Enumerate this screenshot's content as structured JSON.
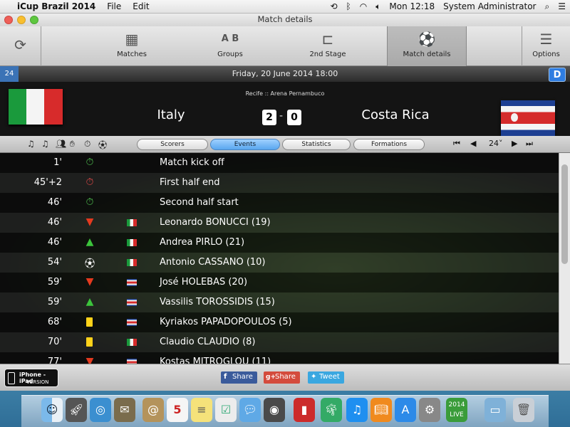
{
  "menubar": {
    "app_name": "iCup Brazil 2014",
    "menus": [
      "File",
      "Edit"
    ],
    "clock": "Mon 12:18",
    "user": "System Administrator"
  },
  "window": {
    "title": "Match details"
  },
  "toolbar": {
    "items": [
      {
        "label": "Matches",
        "icon": "calendar-icon"
      },
      {
        "label": "Groups",
        "icon": "groups-icon"
      },
      {
        "label": "2nd Stage",
        "icon": "bracket-icon"
      },
      {
        "label": "Match details",
        "icon": "soccer-ball-icon"
      },
      {
        "label": "Options",
        "icon": "list-icon"
      }
    ]
  },
  "match": {
    "number": "24",
    "date": "Friday, 20 June 2014 18:00",
    "group": "D",
    "venue": "Recife :: Arena Pernambuco",
    "home_team": "Italy",
    "away_team": "Costa Rica",
    "home_score": "2",
    "away_score": "0"
  },
  "tabs": [
    {
      "label": "Scorers",
      "selected": false
    },
    {
      "label": "Events",
      "selected": true
    },
    {
      "label": "Statistics",
      "selected": false
    },
    {
      "label": "Formations",
      "selected": false
    }
  ],
  "pager": {
    "value": "24"
  },
  "events": [
    {
      "minute": "1'",
      "icon": "stopwatch-green",
      "team": "",
      "text": "Match kick off"
    },
    {
      "minute": "45'+2",
      "icon": "stopwatch-red",
      "team": "",
      "text": "First half end"
    },
    {
      "minute": "46'",
      "icon": "stopwatch-green",
      "team": "",
      "text": "Second half start"
    },
    {
      "minute": "46'",
      "icon": "arrow-down-red",
      "team": "italy",
      "text": "Leonardo BONUCCI (19)"
    },
    {
      "minute": "46'",
      "icon": "arrow-up-green",
      "team": "italy",
      "text": "Andrea PIRLO (21)"
    },
    {
      "minute": "54'",
      "icon": "soccer-ball",
      "team": "italy",
      "text": "Antonio CASSANO (10)"
    },
    {
      "minute": "59'",
      "icon": "arrow-down-red",
      "team": "costa-rica",
      "text": "José HOLEBAS (20)"
    },
    {
      "minute": "59'",
      "icon": "arrow-up-green",
      "team": "costa-rica",
      "text": "Vassilis TOROSSIDIS (15)"
    },
    {
      "minute": "68'",
      "icon": "yellow-card",
      "team": "costa-rica",
      "text": "Kyriakos PAPADOPOULOS (5)"
    },
    {
      "minute": "70'",
      "icon": "yellow-card",
      "team": "italy",
      "text": "Claudio CLAUDIO (8)"
    },
    {
      "minute": "77'",
      "icon": "arrow-down-red",
      "team": "costa-rica",
      "text": "Kostas MITROGLOU (11)"
    }
  ],
  "bottom": {
    "badge_line1": "iPhone - iPad",
    "badge_line2": "VERSION",
    "share_facebook": "Share",
    "share_google": "Share",
    "tweet": "Tweet"
  },
  "colors": {
    "accent_blue": "#2f7de1",
    "selected_tab": "#5aa7ef"
  }
}
